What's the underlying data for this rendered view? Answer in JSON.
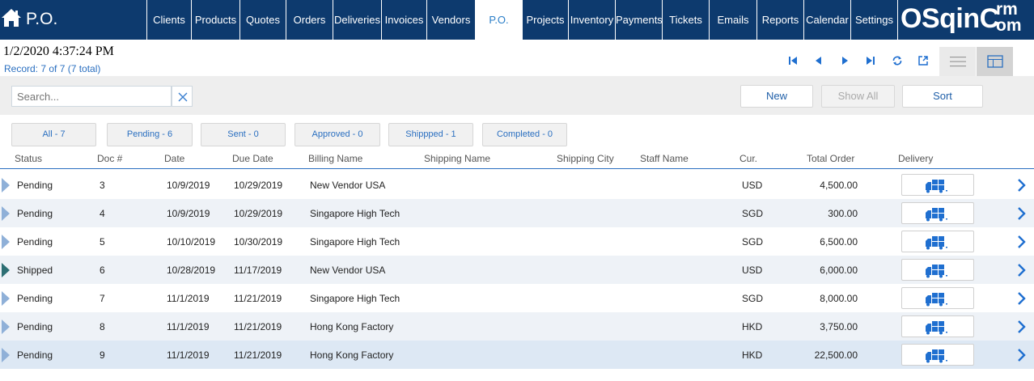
{
  "nav": {
    "module_title": "P.O.",
    "tabs": [
      {
        "label": "Clients"
      },
      {
        "label": "Products"
      },
      {
        "label": "Quotes"
      },
      {
        "label": "Orders"
      },
      {
        "label": "Deliveries"
      },
      {
        "label": "Invoices"
      },
      {
        "label": "Vendors"
      },
      {
        "label": "P.O.",
        "active": true
      },
      {
        "label": "Projects"
      },
      {
        "label": "Inventory"
      },
      {
        "label": "Payments"
      },
      {
        "label": "Tickets"
      },
      {
        "label": "Emails"
      },
      {
        "label": "Reports"
      },
      {
        "label": "Calendar"
      },
      {
        "label": "Settings"
      }
    ],
    "logo": {
      "main": "OSqinC",
      "sup": "rm",
      "sub": "om"
    }
  },
  "header": {
    "datetime": "1/2/2020 4:37:24 PM",
    "record": "Record:  7 of 7 (7 total)"
  },
  "toolbar": {
    "search_placeholder": "Search...",
    "new_label": "New",
    "show_all_label": "Show All",
    "sort_label": "Sort"
  },
  "filters": [
    {
      "label": "All  - 7"
    },
    {
      "label": "Pending - 6"
    },
    {
      "label": "Sent - 0"
    },
    {
      "label": "Approved - 0"
    },
    {
      "label": "Shippped - 1"
    },
    {
      "label": "Completed - 0"
    }
  ],
  "columns": {
    "status": "Status",
    "doc": "Doc #",
    "date": "Date",
    "due_date": "Due Date",
    "billing_name": "Billing Name",
    "shipping_name": "Shipping Name",
    "shipping_city": "Shipping City",
    "staff_name": "Staff Name",
    "currency": "Cur.",
    "total_order": "Total Order",
    "delivery": "Delivery"
  },
  "rows": [
    {
      "status": "Pending",
      "doc": "3",
      "date": "10/9/2019",
      "due": "10/29/2019",
      "billing": "New Vendor USA",
      "cur": "USD",
      "total": "4,500.00"
    },
    {
      "status": "Pending",
      "doc": "4",
      "date": "10/9/2019",
      "due": "10/29/2019",
      "billing": "Singapore High Tech",
      "cur": "SGD",
      "total": "300.00"
    },
    {
      "status": "Pending",
      "doc": "5",
      "date": "10/10/2019",
      "due": "10/30/2019",
      "billing": "Singapore High Tech",
      "cur": "SGD",
      "total": "6,500.00"
    },
    {
      "status": "Shipped",
      "doc": "6",
      "date": "10/28/2019",
      "due": "11/17/2019",
      "billing": "New Vendor USA",
      "cur": "USD",
      "total": "6,000.00"
    },
    {
      "status": "Pending",
      "doc": "7",
      "date": "11/1/2019",
      "due": "11/21/2019",
      "billing": "Singapore High Tech",
      "cur": "SGD",
      "total": "8,000.00"
    },
    {
      "status": "Pending",
      "doc": "8",
      "date": "11/1/2019",
      "due": "11/21/2019",
      "billing": "Hong Kong Factory",
      "cur": "HKD",
      "total": "3,750.00"
    },
    {
      "status": "Pending",
      "doc": "9",
      "date": "11/1/2019",
      "due": "11/21/2019",
      "billing": "Hong Kong Factory",
      "cur": "HKD",
      "total": "22,500.00"
    }
  ],
  "icons": {
    "home": "home-icon",
    "first": "first-page-icon",
    "prev": "previous-icon",
    "next": "next-icon",
    "last": "last-page-icon",
    "refresh": "refresh-icon",
    "popout": "open-external-icon",
    "list_view": "list-view-icon",
    "grid_view": "grid-view-icon",
    "clear": "close-icon",
    "delivery": "delivery-truck-icon",
    "row_open": "chevron-right-icon"
  },
  "colors": {
    "nav_bg": "#0d3a6e",
    "accent": "#2a6fc0",
    "pending_marker": "#8fb0d8",
    "shipped_marker": "#2d6f74"
  }
}
